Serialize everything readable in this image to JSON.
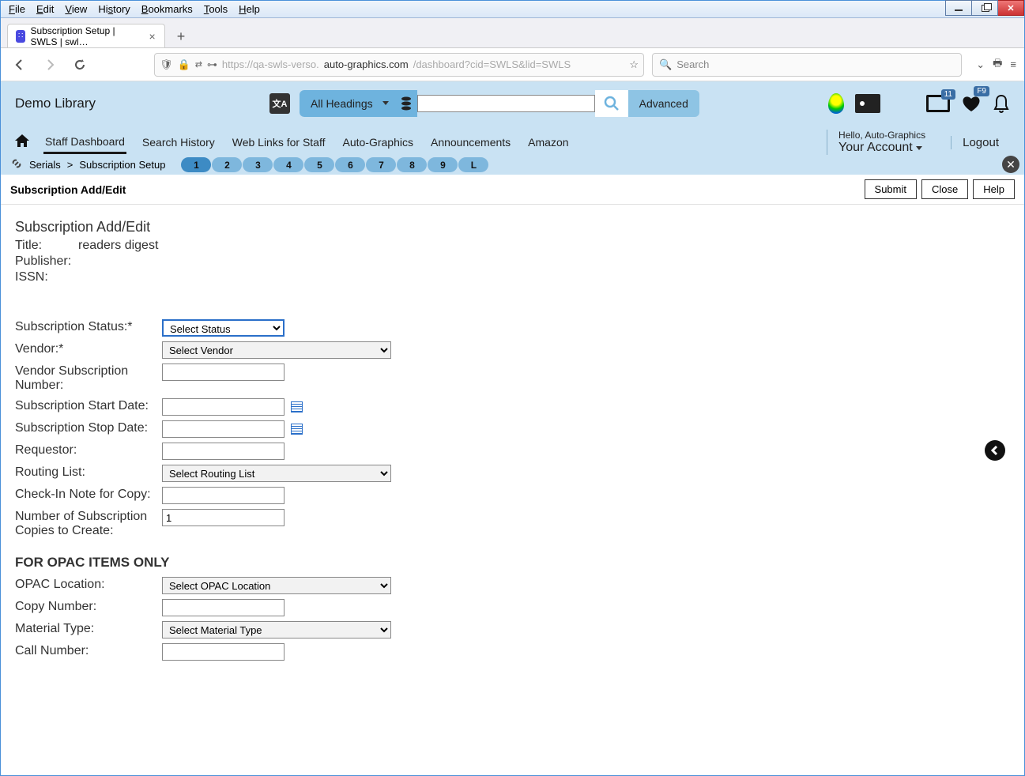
{
  "browser": {
    "menus": [
      "File",
      "Edit",
      "View",
      "History",
      "Bookmarks",
      "Tools",
      "Help"
    ],
    "tab_title": "Subscription Setup | SWLS | swl…",
    "url_faded_pre": "https://qa-swls-verso.",
    "url_dark": "auto-graphics.com",
    "url_faded_post": "/dashboard?cid=SWLS&lid=SWLS",
    "search_placeholder": "Search"
  },
  "header": {
    "brand": "Demo Library",
    "headings_label": "All Headings",
    "advanced_label": "Advanced",
    "clip_badge": "11",
    "heart_badge": "F9",
    "nav": [
      "Staff Dashboard",
      "Search History",
      "Web Links for Staff",
      "Auto-Graphics",
      "Announcements",
      "Amazon"
    ],
    "hello": "Hello, Auto-Graphics",
    "account": "Your Account",
    "logout": "Logout"
  },
  "breadcrumb": {
    "serials": "Serials",
    "sep": ">",
    "current": "Subscription Setup",
    "pills": [
      "1",
      "2",
      "3",
      "4",
      "5",
      "6",
      "7",
      "8",
      "9",
      "L"
    ]
  },
  "actionbar": {
    "title": "Subscription Add/Edit",
    "submit": "Submit",
    "close": "Close",
    "help": "Help"
  },
  "form": {
    "heading": "Subscription Add/Edit",
    "title_label": "Title:",
    "title_value": "readers digest",
    "publisher_label": "Publisher:",
    "publisher_value": "",
    "issn_label": "ISSN:",
    "issn_value": "",
    "status_label": "Subscription Status:*",
    "status_placeholder": "Select Status",
    "vendor_label": "Vendor:*",
    "vendor_placeholder": "Select Vendor",
    "vsn_label": "Vendor Subscription Number:",
    "start_label": "Subscription Start Date:",
    "stop_label": "Subscription Stop Date:",
    "requestor_label": "Requestor:",
    "rlist_label": "Routing List:",
    "rlist_placeholder": "Select Routing List",
    "checkin_label": "Check-In Note for Copy:",
    "copies_label": "Number of Subscription Copies to Create:",
    "copies_value": "1",
    "opac_section": "FOR OPAC ITEMS ONLY",
    "opac_loc_label": "OPAC Location:",
    "opac_loc_placeholder": "Select OPAC Location",
    "copy_num_label": "Copy Number:",
    "mtype_label": "Material Type:",
    "mtype_placeholder": "Select Material Type",
    "callnum_label": "Call Number:"
  }
}
